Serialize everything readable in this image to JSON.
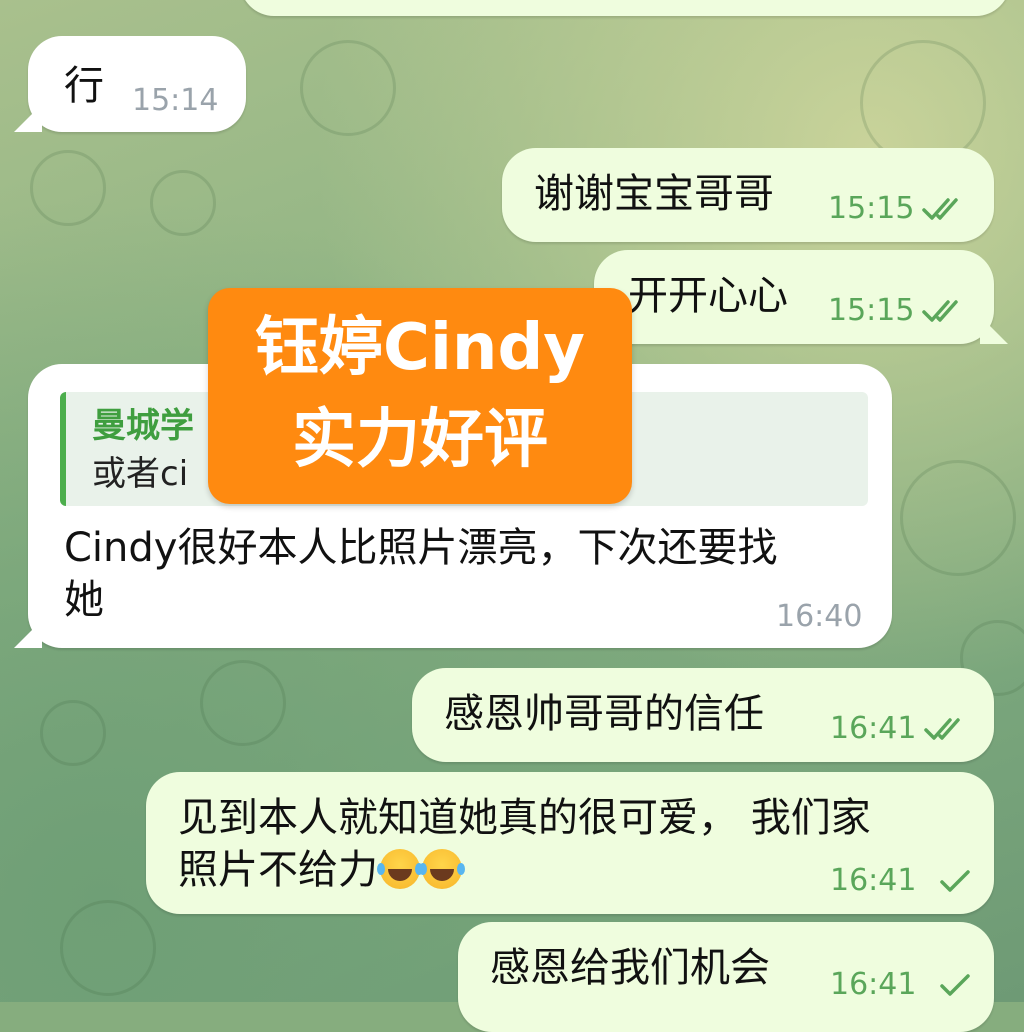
{
  "messages": [
    {
      "direction": "incoming",
      "text": "行",
      "time": "15:14"
    },
    {
      "direction": "outgoing",
      "text": "谢谢宝宝哥哥",
      "time": "15:15",
      "status": "read"
    },
    {
      "direction": "outgoing",
      "text": "开开心心",
      "time": "15:15",
      "status": "read"
    },
    {
      "direction": "incoming",
      "reply_to": {
        "sender": "曼城学",
        "text": "或者ci"
      },
      "text_line1": "Cindy很好本人比照片漂亮，下次还要找",
      "text_line2": "她",
      "time": "16:40"
    },
    {
      "direction": "outgoing",
      "text": "感恩帅哥哥的信任",
      "time": "16:41",
      "status": "read"
    },
    {
      "direction": "outgoing",
      "text_line1": "见到本人就知道她真的很可爱， 我们家",
      "text_line2": "照片不给力",
      "emoji": [
        "face-with-tears-of-joy-icon",
        "face-with-tears-of-joy-icon"
      ],
      "time": "16:41",
      "status": "sent"
    },
    {
      "direction": "outgoing",
      "text": "感恩给我们机会",
      "time": "16:41",
      "status": "sent"
    }
  ],
  "overlay": {
    "line1": "钰婷Cindy",
    "line2": "实力好评",
    "color": "#ff8a10"
  },
  "colors": {
    "incoming_bubble": "#ffffff",
    "outgoing_bubble": "#effdde",
    "outgoing_time": "#5aa65a",
    "incoming_time": "#9aa3ab",
    "reply_accent": "#4cae4c"
  }
}
